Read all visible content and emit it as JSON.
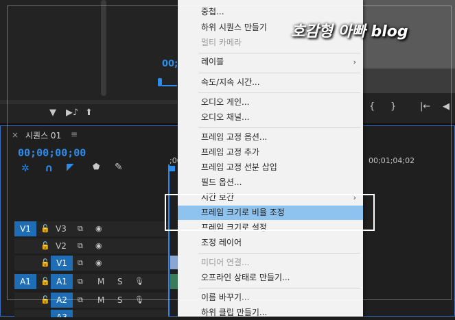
{
  "watermark": "호감형 아빠 blog",
  "source_monitor": {
    "timecode": "00;0",
    "icons": [
      "filter-icon",
      "insert-icon",
      "export-frame-icon"
    ]
  },
  "program_monitor": {
    "controls": [
      "{",
      "}",
      "|←",
      "◀"
    ]
  },
  "timeline": {
    "close": "×",
    "tab_title": "시퀀스 01",
    "tab_menu": "≡",
    "timecode": "00;00;00;00",
    "ruler_start": ";00",
    "ruler_mark": "00;01;04;02",
    "tracks": [
      {
        "src": "V1",
        "name": "V3",
        "type": "video"
      },
      {
        "src": "",
        "name": "V2",
        "type": "video"
      },
      {
        "src": "",
        "name": "V1",
        "type": "video",
        "target": true
      },
      {
        "src": "A1",
        "name": "A1",
        "type": "audio",
        "target": true
      },
      {
        "src": "",
        "name": "A2",
        "type": "audio",
        "target": true
      },
      {
        "src": "",
        "name": "A3",
        "type": "audio",
        "target": true
      }
    ],
    "mute": "M",
    "solo": "S"
  },
  "menu": {
    "items": [
      {
        "label": "중첩...",
        "disabled": false
      },
      {
        "label": "하위 시퀀스 만들기",
        "disabled": false
      },
      {
        "label": "멀티 카메라",
        "disabled": true
      },
      {
        "label": "레이블",
        "disabled": false,
        "submenu": true
      },
      {
        "label": "속도/지속 시간...",
        "disabled": false
      },
      {
        "label": "오디오 게인...",
        "disabled": false
      },
      {
        "label": "오디오 채널...",
        "disabled": false
      },
      {
        "label": "프레임 고정 옵션...",
        "disabled": false
      },
      {
        "label": "프레임 고정 추가",
        "disabled": false
      },
      {
        "label": "프레임 고정 선분 삽입",
        "disabled": false
      },
      {
        "label": "필드 옵션...",
        "disabled": false
      },
      {
        "label": "시간 보간",
        "disabled": false,
        "submenu": true
      },
      {
        "label": "프레임 크기로 비율 조정",
        "disabled": false,
        "selected": true
      },
      {
        "label": "프레임 크기로 설정",
        "disabled": false
      },
      {
        "label": "조정 레이어",
        "disabled": false
      },
      {
        "label": "미디어 연결...",
        "disabled": true
      },
      {
        "label": "오프라인 상태로 만들기...",
        "disabled": false
      },
      {
        "label": "이름 바꾸기...",
        "disabled": false
      },
      {
        "label": "하위 클립 만들기...",
        "disabled": false
      }
    ],
    "submenu_arrow": "›"
  },
  "colors": {
    "accent": "#2d8ceb",
    "track_target": "#1f6db5",
    "menu_select": "#8fc3ef"
  }
}
